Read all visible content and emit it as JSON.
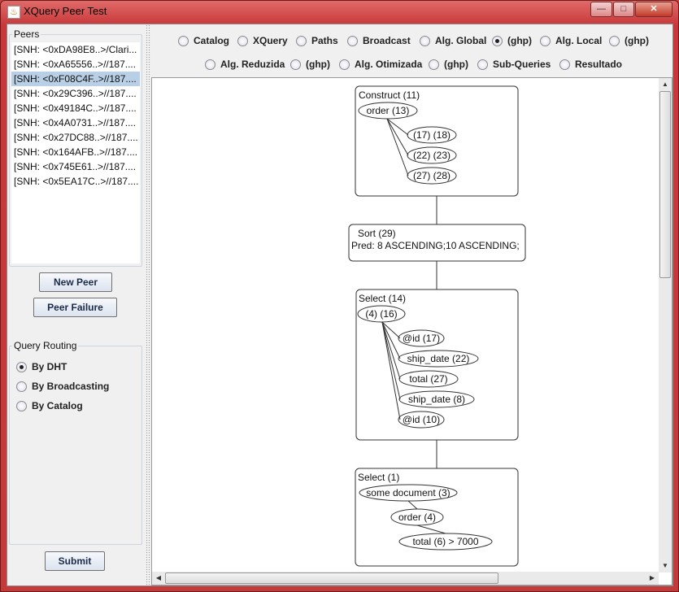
{
  "window": {
    "title": "XQuery Peer Test",
    "controls": {
      "minimize": "—",
      "maximize": "□",
      "close": "✕"
    }
  },
  "peers": {
    "legend": "Peers",
    "items": [
      "[SNH: <0xDA98E8..>/Clari...",
      "[SNH: <0xA65556..>//187....",
      "[SNH: <0xF08C4F..>//187....",
      "[SNH: <0x29C396..>//187....",
      "[SNH: <0x49184C..>//187....",
      "[SNH: <0x4A0731..>//187....",
      "[SNH: <0x27DC88..>//187....",
      "[SNH: <0x164AFB..>//187....",
      "[SNH: <0x745E61..>//187....",
      "[SNH: <0x5EA17C..>//187...."
    ],
    "selected_index": 2
  },
  "buttons": {
    "new_peer": "New Peer",
    "peer_failure": "Peer Failure",
    "submit": "Submit"
  },
  "routing": {
    "legend": "Query Routing",
    "options": [
      "By DHT",
      "By Broadcasting",
      "By Catalog"
    ],
    "selected": "By DHT"
  },
  "views": {
    "row1": [
      "Catalog",
      "XQuery",
      "Paths",
      "Broadcast",
      "Alg. Global",
      "(ghp)",
      "Alg. Local",
      "(ghp)"
    ],
    "row2": [
      "Alg. Reduzida",
      "(ghp)",
      "Alg. Otimizada",
      "(ghp)",
      "Sub-Queries",
      "Resultado"
    ],
    "selected": "row1.5"
  },
  "plan": {
    "construct": {
      "label": "Construct  (11)",
      "root": "order (13)",
      "children": [
        "(17) (18)",
        "(22) (23)",
        "(27) (28)"
      ]
    },
    "sort": {
      "label": "Sort  (29)",
      "pred": "Pred: 8 ASCENDING;10 ASCENDING;"
    },
    "select14": {
      "label": "Select  (14)",
      "root": "(4) (16)",
      "children": [
        "@id (17)",
        "ship_date (22)",
        "total (27)",
        "ship_date (8)",
        "@id (10)"
      ]
    },
    "select1": {
      "label": "Select  (1)",
      "nodes": [
        "some document (3)",
        "order (4)",
        "total (6) > 7000"
      ]
    }
  }
}
